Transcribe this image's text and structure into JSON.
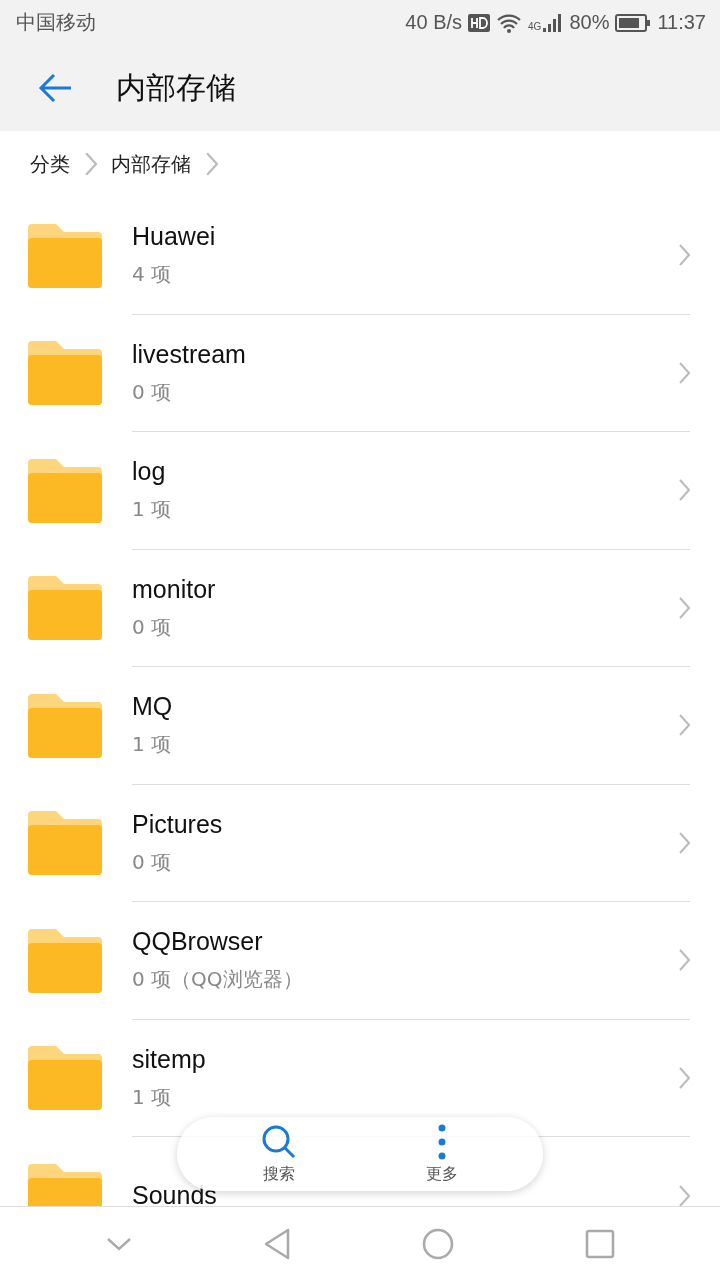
{
  "status_bar": {
    "carrier": "中国移动",
    "speed": "40 B/s",
    "network": "4G",
    "battery": "80%",
    "time": "11:37"
  },
  "header": {
    "title": "内部存储"
  },
  "breadcrumbs": [
    "分类",
    "内部存储"
  ],
  "folders": [
    {
      "name": "Huawei",
      "info": "4 项"
    },
    {
      "name": "livestream",
      "info": "0 项"
    },
    {
      "name": "log",
      "info": "1 项"
    },
    {
      "name": "monitor",
      "info": "0 项"
    },
    {
      "name": "MQ",
      "info": "1 项"
    },
    {
      "name": "Pictures",
      "info": "0 项"
    },
    {
      "name": "QQBrowser",
      "info": "0 项（QQ浏览器）"
    },
    {
      "name": "sitemp",
      "info": "1 项"
    },
    {
      "name": "Sounds"
    }
  ],
  "floating_bar": [
    {
      "kind": "search",
      "label": "搜索"
    },
    {
      "kind": "more",
      "label": "更多"
    }
  ]
}
